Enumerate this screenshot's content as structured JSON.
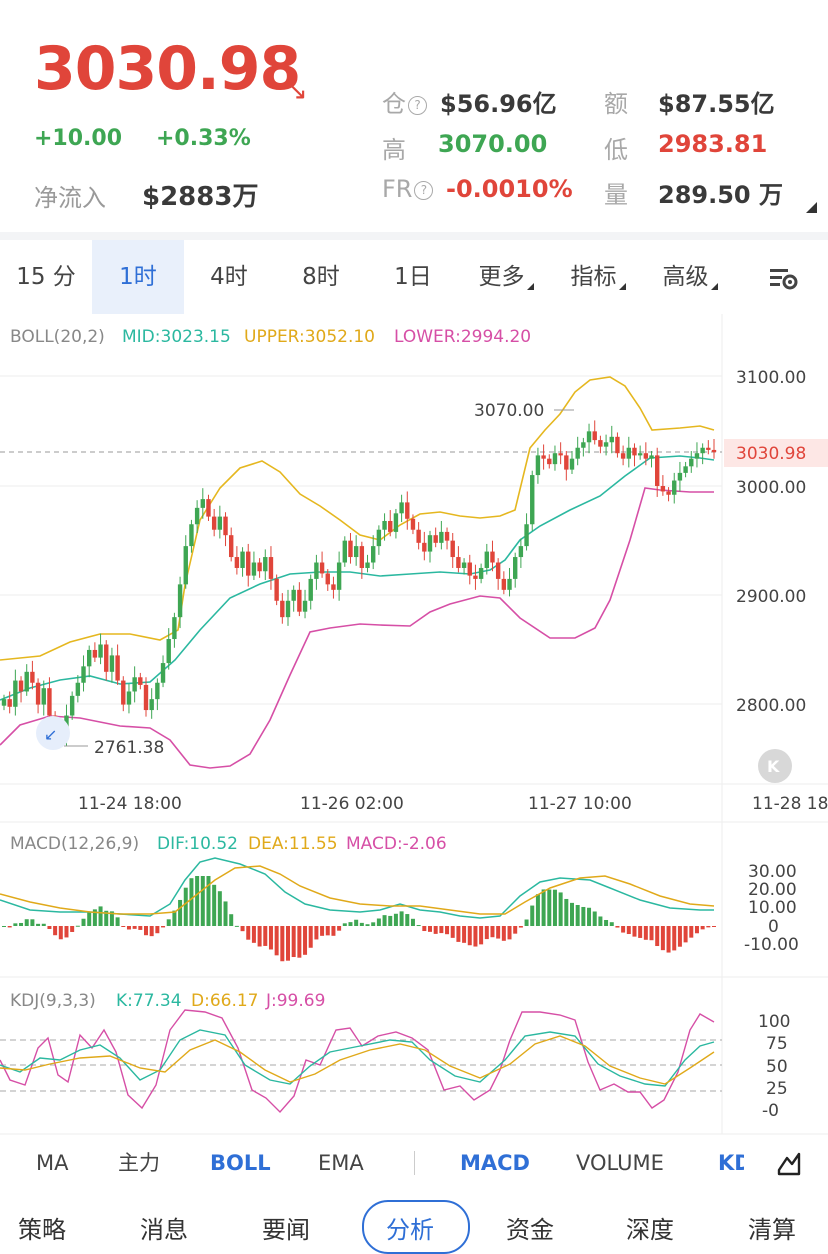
{
  "header": {
    "price": "3030.98",
    "change": "+10.00",
    "change_pct": "+0.33%",
    "net_inflow_label": "净流入",
    "net_inflow_value": "$2883万",
    "stats": {
      "position_label": "仓",
      "position_value": "$56.96亿",
      "amount_label": "额",
      "amount_value": "$87.55亿",
      "high_label": "高",
      "high_value": "3070.00",
      "low_label": "低",
      "low_value": "2983.81",
      "fr_label": "FR",
      "fr_value": "-0.0010%",
      "volume_label": "量",
      "volume_value": "289.50 万"
    },
    "colors": {
      "up": "#3ea653",
      "down": "#e0453a",
      "accent": "#2f6fd6"
    }
  },
  "intervals": {
    "items": [
      "15 分",
      "1时",
      "4时",
      "8时",
      "1日",
      "更多",
      "指标",
      "高级"
    ],
    "active": "1时",
    "settings_icon": "chart-settings-icon"
  },
  "boll": {
    "title": "BOLL(20,2)",
    "mid": "MID:3023.15",
    "upper": "UPPER:3052.10",
    "lower": "LOWER:2994.20",
    "price_axis": [
      "3100.00",
      "3000.00",
      "2900.00",
      "2800.00"
    ],
    "current_price_tag": "3030.98",
    "high_marker": "3070.00",
    "low_marker": "2761.38",
    "time_axis": [
      "11-24 18:00",
      "11-26 02:00",
      "11-27 10:00",
      "11-28 18"
    ]
  },
  "macd": {
    "title": "MACD(12,26,9)",
    "dif": "DIF:10.52",
    "dea": "DEA:11.55",
    "macd": "MACD:-2.06",
    "axis": [
      "30.00",
      "20.00",
      "10.00",
      "0",
      "-10.00"
    ]
  },
  "kdj": {
    "title": "KDJ(9,3,3)",
    "k": "K:77.34",
    "d": "D:66.17",
    "j": "J:99.69",
    "axis": [
      "100",
      "75",
      "50",
      "25",
      "-0"
    ]
  },
  "indicator_tabs": {
    "items": [
      "MA",
      "主力",
      "BOLL",
      "EMA",
      "MACD",
      "VOLUME",
      "KD"
    ],
    "active_main": "BOLL",
    "active_sub": "MACD",
    "draw_icon": "drawing-tool-icon"
  },
  "nav": {
    "items": [
      "策略",
      "消息",
      "要闻",
      "分析",
      "资金",
      "深度",
      "清算"
    ],
    "active": "分析"
  },
  "chart_data": {
    "type": "candlestick",
    "title": "",
    "timeframe": "1时",
    "x_ticks": [
      "11-24 18:00",
      "11-26 02:00",
      "11-27 10:00",
      "11-28 18"
    ],
    "y_ticks": [
      2800,
      2900,
      3000,
      3100
    ],
    "ylim": [
      2750,
      3125
    ],
    "last_close": 3030.98,
    "high": 3070.0,
    "low": 2761.38,
    "boll": {
      "mid": 3023.15,
      "upper": 3052.1,
      "lower": 2994.2
    },
    "macd": {
      "dif": 10.52,
      "dea": 11.55,
      "macd": -2.06,
      "ylim": [
        -15,
        35
      ]
    },
    "kdj": {
      "k": 77.34,
      "d": 66.17,
      "j": 99.69,
      "ylim": [
        -10,
        110
      ]
    },
    "closes": [
      2805,
      2798,
      2822,
      2812,
      2830,
      2820,
      2800,
      2815,
      2790,
      2775,
      2772,
      2790,
      2808,
      2820,
      2835,
      2850,
      2843,
      2855,
      2830,
      2845,
      2822,
      2800,
      2812,
      2825,
      2818,
      2795,
      2805,
      2820,
      2838,
      2860,
      2880,
      2910,
      2945,
      2965,
      2980,
      2988,
      2972,
      2960,
      2972,
      2955,
      2935,
      2925,
      2940,
      2918,
      2930,
      2922,
      2935,
      2915,
      2895,
      2880,
      2895,
      2905,
      2885,
      2895,
      2915,
      2930,
      2920,
      2910,
      2905,
      2930,
      2950,
      2935,
      2945,
      2925,
      2930,
      2945,
      2960,
      2968,
      2958,
      2975,
      2985,
      2970,
      2960,
      2948,
      2940,
      2955,
      2948,
      2958,
      2950,
      2935,
      2925,
      2930,
      2918,
      2915,
      2925,
      2940,
      2930,
      2915,
      2905,
      2915,
      2935,
      2945,
      2965,
      3010,
      3028,
      3025,
      3020,
      3030,
      3028,
      3015,
      3025,
      3035,
      3040,
      3050,
      3042,
      3036,
      3040,
      3045,
      3030,
      3025,
      3035,
      3028,
      3030,
      3025,
      3028,
      3000,
      2995,
      2992,
      3005,
      3012,
      3018,
      3025,
      3030,
      3035,
      3033,
      3030.98
    ]
  }
}
